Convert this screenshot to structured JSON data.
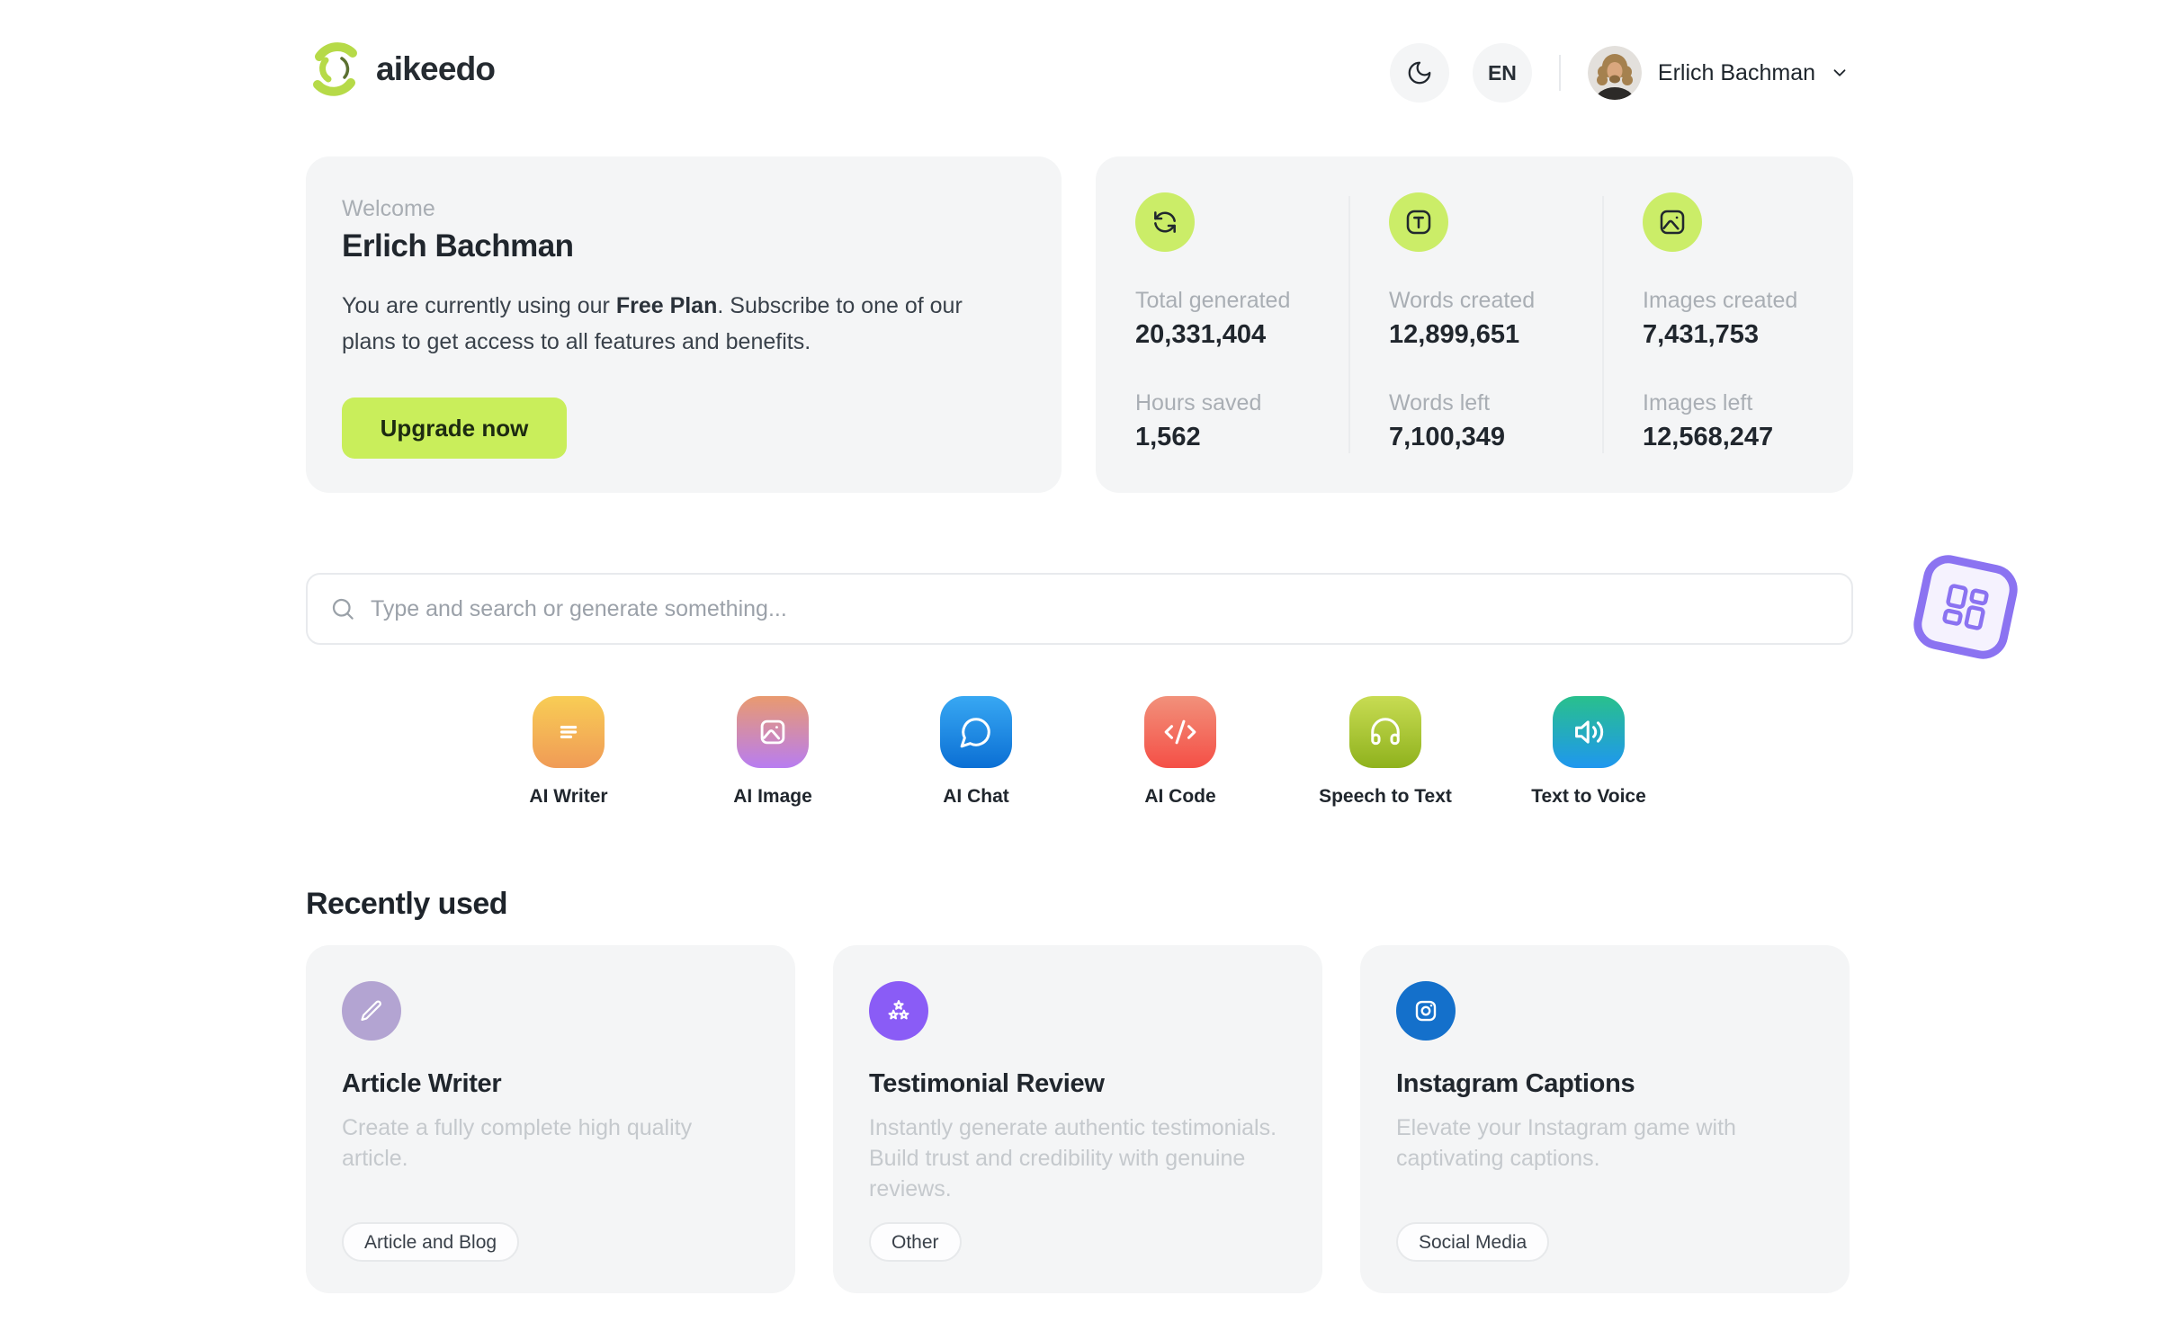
{
  "header": {
    "logo_text": "aikeedo",
    "language": "EN",
    "user_name": "Erlich Bachman"
  },
  "welcome": {
    "label": "Welcome",
    "name": "Erlich Bachman",
    "message_prefix": "You are currently using our ",
    "plan": "Free Plan",
    "message_suffix": ". Subscribe to one of our plans to get access to all features and benefits.",
    "cta": "Upgrade now"
  },
  "stats": {
    "columns": [
      {
        "icon": "refresh-icon",
        "top_label": "Total generated",
        "top_value": "20,331,404",
        "bottom_label": "Hours saved",
        "bottom_value": "1,562"
      },
      {
        "icon": "type-icon",
        "top_label": "Words created",
        "top_value": "12,899,651",
        "bottom_label": "Words left",
        "bottom_value": "7,100,349"
      },
      {
        "icon": "image-icon",
        "top_label": "Images created",
        "top_value": "7,431,753",
        "bottom_label": "Images left",
        "bottom_value": "12,568,247"
      }
    ]
  },
  "search": {
    "placeholder": "Type and search or generate something..."
  },
  "tools": {
    "items": [
      {
        "label": "AI Writer",
        "icon": "text-lines-icon",
        "gradient": [
          "#f8cd55",
          "#f09b56"
        ]
      },
      {
        "label": "AI Image",
        "icon": "image-icon",
        "gradient": [
          "#e99a6f",
          "#b87df1"
        ]
      },
      {
        "label": "AI Chat",
        "icon": "chat-bubble-icon",
        "gradient": [
          "#38a8f3",
          "#0b6fd4"
        ]
      },
      {
        "label": "AI Code",
        "icon": "code-icon",
        "gradient": [
          "#f2917b",
          "#f44f46"
        ]
      },
      {
        "label": "Speech to Text",
        "icon": "headphones-icon",
        "gradient": [
          "#c8dc53",
          "#8fb21d"
        ]
      },
      {
        "label": "Text to Voice",
        "icon": "speaker-icon",
        "gradient": [
          "#29c08c",
          "#1f97ef"
        ]
      }
    ]
  },
  "recent": {
    "heading": "Recently used",
    "cards": [
      {
        "title": "Article Writer",
        "description": "Create a fully complete high quality article.",
        "tag": "Article and Blog",
        "icon": "pencil-icon",
        "icon_bg": "#b3a4d2"
      },
      {
        "title": "Testimonial Review",
        "description": "Instantly generate authentic testimonials. Build trust and credibility with genuine reviews.",
        "tag": "Other",
        "icon": "stars-icon",
        "icon_bg": "#8a5cf6"
      },
      {
        "title": "Instagram Captions",
        "description": "Elevate your Instagram game with captivating captions.",
        "tag": "Social Media",
        "icon": "instagram-icon",
        "icon_bg": "#1470cb"
      }
    ]
  },
  "colors": {
    "accent_lime": "#c9ee5b",
    "stat_circle_lime": "#cbed68",
    "card_background": "#f4f5f6",
    "text_dark": "#21272e",
    "text_gray": "#a9aeb4",
    "text_faint": "#c5c9cd",
    "sticker_purple": "#8b73f1",
    "logo_lime": "#b6da48"
  }
}
